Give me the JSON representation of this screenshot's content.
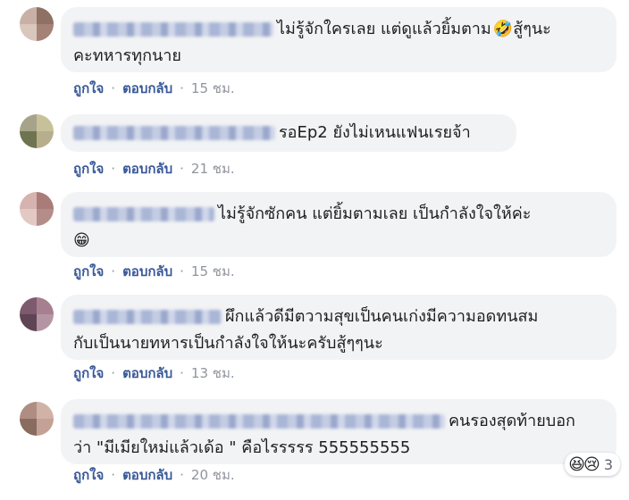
{
  "comments": [
    {
      "text_line1": "ไม่รู้จักใครเลย แต่ดูแล้วยิ้มตาม",
      "emoji": "🤣",
      "text_line1_tail": " สู้ๆนะ",
      "text_line2": "คะทหารทุกนาย",
      "like": "ถูกใจ",
      "reply": "ตอบกลับ",
      "time": "15 ชม.",
      "avatar_colors": [
        "#c9b0a6",
        "#8f7065",
        "#d9c6bd",
        "#a48376"
      ]
    },
    {
      "text_line1": "รอEp2 ยังไม่เหนแฟนเรยจ้า",
      "like": "ถูกใจ",
      "reply": "ตอบกลับ",
      "time": "21 ชม.",
      "avatar_colors": [
        "#a7a38a",
        "#c7c19a",
        "#6f7450",
        "#b6ae8d"
      ]
    },
    {
      "text_line1": "ไม่รู้จักซักคน แต่ยิ้มตามเลย เป็นกำลังใจให้ค่ะ",
      "emoji": "😁",
      "like": "ถูกใจ",
      "reply": "ตอบกลับ",
      "time": "15 ชม.",
      "avatar_colors": [
        "#d6b3ae",
        "#a97c79",
        "#e3c9c3",
        "#b58d88"
      ]
    },
    {
      "text_line1": "ผึกแล้วดีมีตวามสุขเป็นคนเก่งมีความอดทนสม",
      "text_line2": "กับเป็นนายทหารเป็นกำลังใจให้นะครับสู้ๆๆนะ",
      "like": "ถูกใจ",
      "reply": "ตอบกลับ",
      "time": "13 ชม.",
      "avatar_colors": [
        "#7d5a6e",
        "#a6808f",
        "#5e4454",
        "#b594a3"
      ]
    },
    {
      "text_line1": "คนรองสุดท้ายบอก",
      "text_line2": "ว่า \"มีเมียใหม่แล้วเด้อ \" คือไรรรรร 555555555",
      "like": "ถูกใจ",
      "reply": "ตอบกลับ",
      "time": "20 ชม.",
      "avatar_colors": [
        "#b08d82",
        "#d0b2a6",
        "#8a6b60",
        "#c4a195"
      ],
      "reactions": {
        "icons": [
          "😆",
          "😢"
        ],
        "count": "3"
      }
    }
  ]
}
